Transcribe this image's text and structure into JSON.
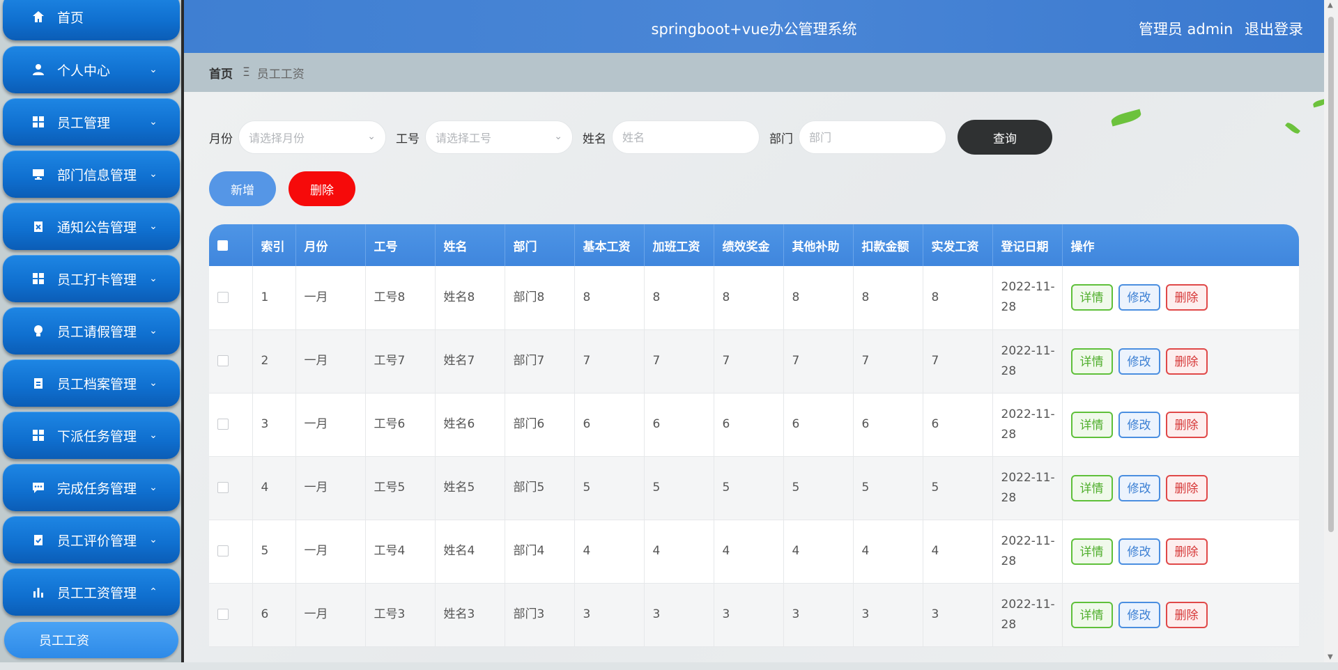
{
  "sidebar": {
    "items": [
      {
        "label": "首页",
        "icon": "home-icon",
        "arrow": ""
      },
      {
        "label": "个人中心",
        "icon": "user-icon",
        "arrow": "down"
      },
      {
        "label": "员工管理",
        "icon": "grid-icon",
        "arrow": "down"
      },
      {
        "label": "部门信息管理",
        "icon": "monitor-icon",
        "arrow": "down"
      },
      {
        "label": "通知公告管理",
        "icon": "clipboard-x-icon",
        "arrow": "down"
      },
      {
        "label": "员工打卡管理",
        "icon": "grid-icon",
        "arrow": "down"
      },
      {
        "label": "员工请假管理",
        "icon": "bulb-icon",
        "arrow": "down"
      },
      {
        "label": "员工档案管理",
        "icon": "clipboard-icon",
        "arrow": "down"
      },
      {
        "label": "下派任务管理",
        "icon": "grid-icon",
        "arrow": "down"
      },
      {
        "label": "完成任务管理",
        "icon": "chat-icon",
        "arrow": "down"
      },
      {
        "label": "员工评价管理",
        "icon": "clipboard-check-icon",
        "arrow": "down"
      },
      {
        "label": "员工工资管理",
        "icon": "bar-chart-icon",
        "arrow": "up"
      }
    ],
    "active_sub": "员工工资"
  },
  "header": {
    "title": "springboot+vue办公管理系统",
    "user": "管理员 admin",
    "logout": "退出登录"
  },
  "breadcrumb": {
    "home": "首页",
    "sep": "Ξ",
    "current": "员工工资"
  },
  "search": {
    "month_label": "月份",
    "month_placeholder": "请选择月份",
    "id_label": "工号",
    "id_placeholder": "请选择工号",
    "name_label": "姓名",
    "name_placeholder": "姓名",
    "dept_label": "部门",
    "dept_placeholder": "部门",
    "query": "查询"
  },
  "actions": {
    "add": "新增",
    "delete": "删除"
  },
  "colors": {
    "accent": "#4a8ee0",
    "danger": "#f60a0a",
    "header": "#3f7fd2"
  },
  "table": {
    "columns": [
      "",
      "索引",
      "月份",
      "工号",
      "姓名",
      "部门",
      "基本工资",
      "加班工资",
      "绩效奖金",
      "其他补助",
      "扣款金额",
      "实发工资",
      "登记日期",
      "操作"
    ],
    "op_labels": {
      "detail": "详情",
      "edit": "修改",
      "delete": "删除"
    },
    "rows": [
      [
        "1",
        "一月",
        "工号8",
        "姓名8",
        "部门8",
        "8",
        "8",
        "8",
        "8",
        "8",
        "8",
        "2022-11-",
        "28"
      ],
      [
        "2",
        "一月",
        "工号7",
        "姓名7",
        "部门7",
        "7",
        "7",
        "7",
        "7",
        "7",
        "7",
        "2022-11-",
        "28"
      ],
      [
        "3",
        "一月",
        "工号6",
        "姓名6",
        "部门6",
        "6",
        "6",
        "6",
        "6",
        "6",
        "6",
        "2022-11-",
        "28"
      ],
      [
        "4",
        "一月",
        "工号5",
        "姓名5",
        "部门5",
        "5",
        "5",
        "5",
        "5",
        "5",
        "5",
        "2022-11-",
        "28"
      ],
      [
        "5",
        "一月",
        "工号4",
        "姓名4",
        "部门4",
        "4",
        "4",
        "4",
        "4",
        "4",
        "4",
        "2022-11-",
        "28"
      ],
      [
        "6",
        "一月",
        "工号3",
        "姓名3",
        "部门3",
        "3",
        "3",
        "3",
        "3",
        "3",
        "3",
        "2022-11-",
        "28"
      ]
    ]
  }
}
